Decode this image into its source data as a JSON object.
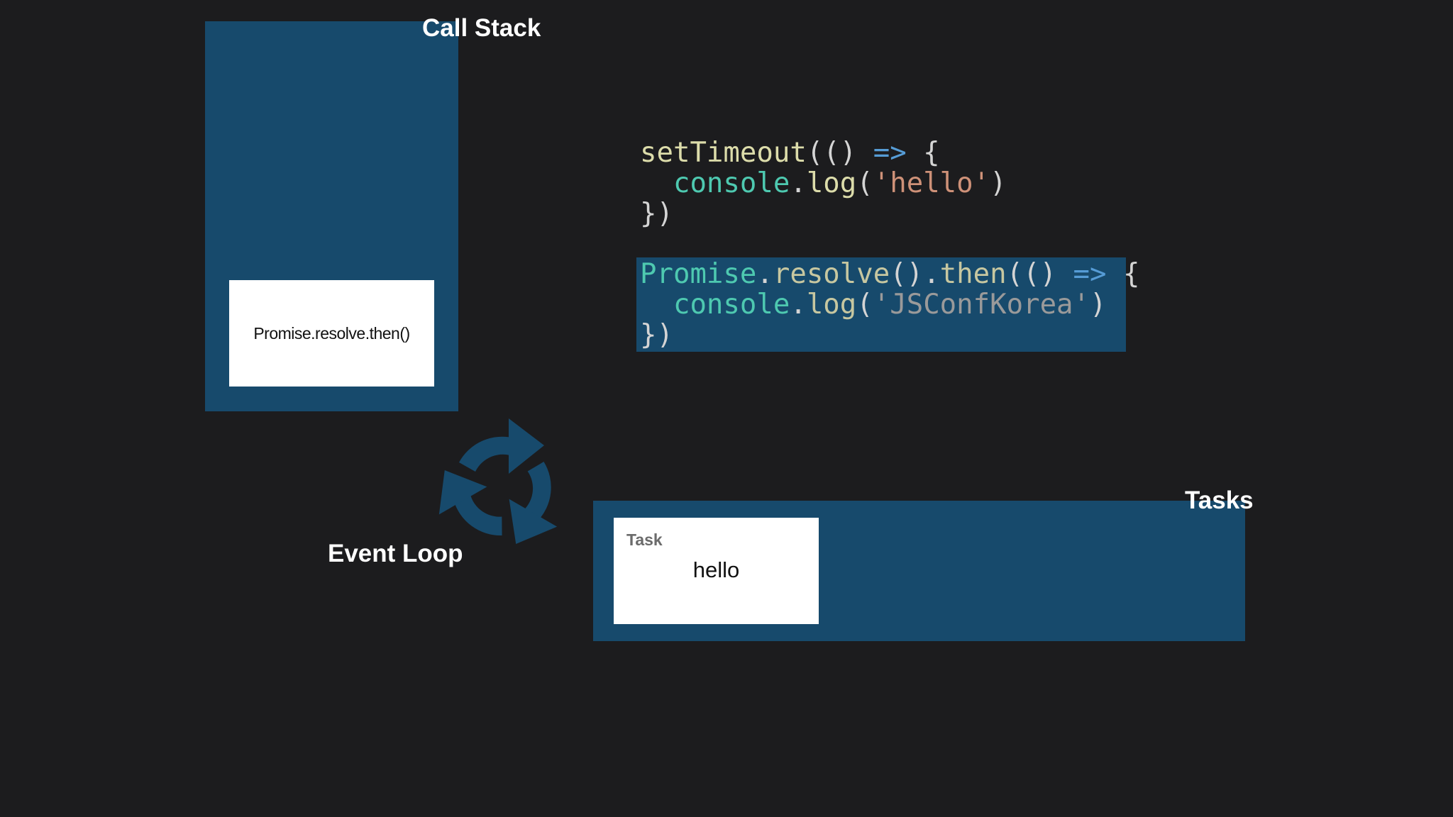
{
  "call_stack": {
    "title": "Call Stack",
    "frames": [
      "Promise.resolve.then()"
    ]
  },
  "code": {
    "block1": {
      "lines": [
        [
          "setTimeout",
          "(() ",
          "=>",
          " {"
        ],
        [
          "  ",
          "console",
          ".",
          "log",
          "(",
          "'hello'",
          ")"
        ],
        [
          "})"
        ]
      ]
    },
    "block2": {
      "lines": [
        [
          "Promise",
          ".",
          "resolve",
          "().",
          "then",
          "(() ",
          "=>",
          " {"
        ],
        [
          "  ",
          "console",
          ".",
          "log",
          "(",
          "'JSConfKorea'",
          ")"
        ],
        [
          "})"
        ]
      ]
    }
  },
  "event_loop": {
    "title": "Event Loop",
    "icon": "refresh-cycle-icon"
  },
  "tasks": {
    "title": "Tasks",
    "items": [
      {
        "label": "Task",
        "value": "hello"
      }
    ]
  },
  "colors": {
    "background": "#1c1c1e",
    "panel": "#174a6c",
    "icon": "#174a6c"
  }
}
